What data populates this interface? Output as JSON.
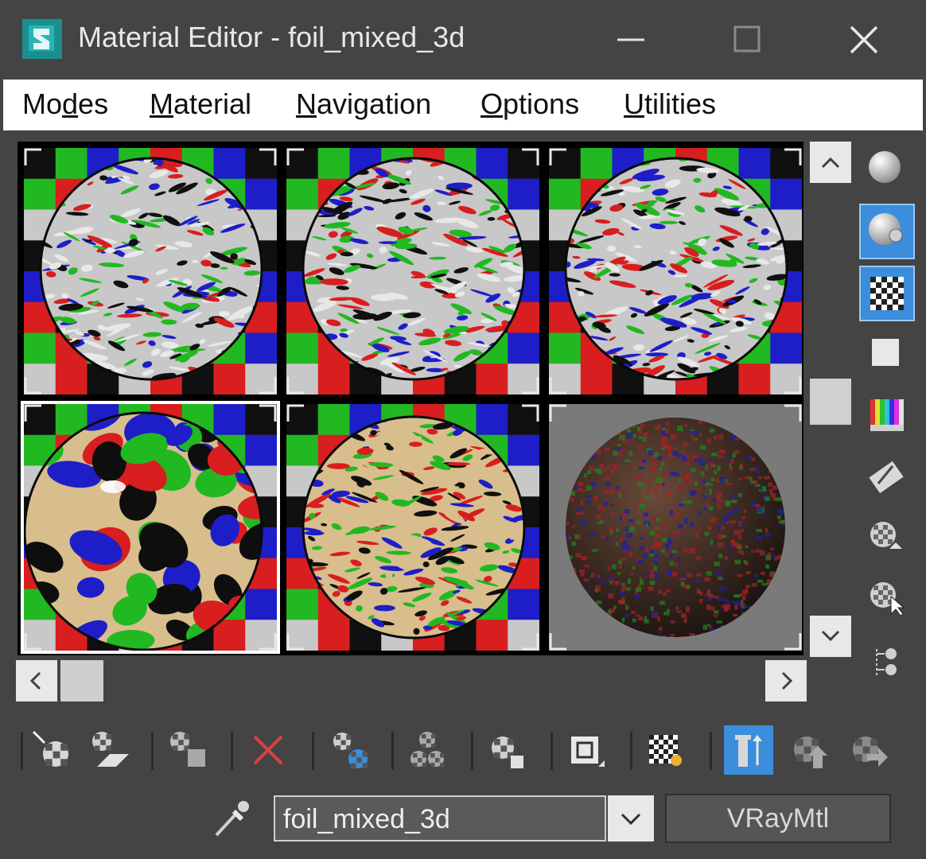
{
  "window": {
    "title": "Material Editor - foil_mixed_3d",
    "minimize_label": "minimize",
    "maximize_label": "maximize",
    "close_label": "close"
  },
  "menu": [
    {
      "pre": "Mo",
      "ul": "d",
      "post": "es"
    },
    {
      "pre": "",
      "ul": "M",
      "post": "aterial"
    },
    {
      "pre": "",
      "ul": "N",
      "post": "avigation"
    },
    {
      "pre": "",
      "ul": "O",
      "post": "ptions"
    },
    {
      "pre": "",
      "ul": "U",
      "post": "tilities"
    }
  ],
  "slots": [
    {
      "name": "slot-1",
      "selected": false,
      "style": "foil-checker"
    },
    {
      "name": "slot-2",
      "selected": false,
      "style": "foil-checker"
    },
    {
      "name": "slot-3",
      "selected": false,
      "style": "foil-checker"
    },
    {
      "name": "slot-4",
      "selected": true,
      "style": "reflective-checker"
    },
    {
      "name": "slot-5",
      "selected": false,
      "style": "foil-beige"
    },
    {
      "name": "slot-6",
      "selected": false,
      "style": "noise-sphere"
    }
  ],
  "side_tools": [
    {
      "icon": "sample-type-sphere-icon",
      "active": false
    },
    {
      "icon": "backlight-icon",
      "active": true
    },
    {
      "icon": "background-checker-icon",
      "active": true
    },
    {
      "icon": "sample-uv-tiling-icon",
      "active": false
    },
    {
      "icon": "video-color-check-icon",
      "active": false
    },
    {
      "icon": "make-preview-icon",
      "active": false
    },
    {
      "icon": "material-options-icon",
      "active": false
    },
    {
      "icon": "select-by-material-icon",
      "active": false
    },
    {
      "icon": "material-map-navigator-icon",
      "active": false
    }
  ],
  "bottom_tools": [
    {
      "icon": "get-material-icon",
      "active": false
    },
    {
      "icon": "put-material-to-scene-icon",
      "active": false
    },
    {
      "icon": "assign-material-to-selection-icon",
      "active": false
    },
    {
      "icon": "reset-map-icon",
      "active": false
    },
    {
      "icon": "make-material-copy-icon",
      "active": false
    },
    {
      "icon": "make-unique-icon",
      "active": false
    },
    {
      "icon": "put-to-library-icon",
      "active": false
    },
    {
      "icon": "material-id-channel-icon",
      "active": false
    },
    {
      "icon": "show-shaded-material-in-viewport-icon",
      "active": false
    },
    {
      "icon": "show-end-result-icon",
      "active": true
    },
    {
      "icon": "go-to-parent-icon",
      "active": false
    },
    {
      "icon": "go-forward-to-sibling-icon",
      "active": false
    }
  ],
  "material_name": "foil_mixed_3d",
  "material_type": "VRayMtl",
  "colors": {
    "chrome_bg": "#444444",
    "accent_active": "#3c8ddc",
    "check_red": "#d81e1e",
    "check_green": "#22b822",
    "check_blue": "#1e1ec8",
    "check_black": "#101010",
    "check_grey": "#c8c8c8",
    "beige": "#d8be8c"
  }
}
